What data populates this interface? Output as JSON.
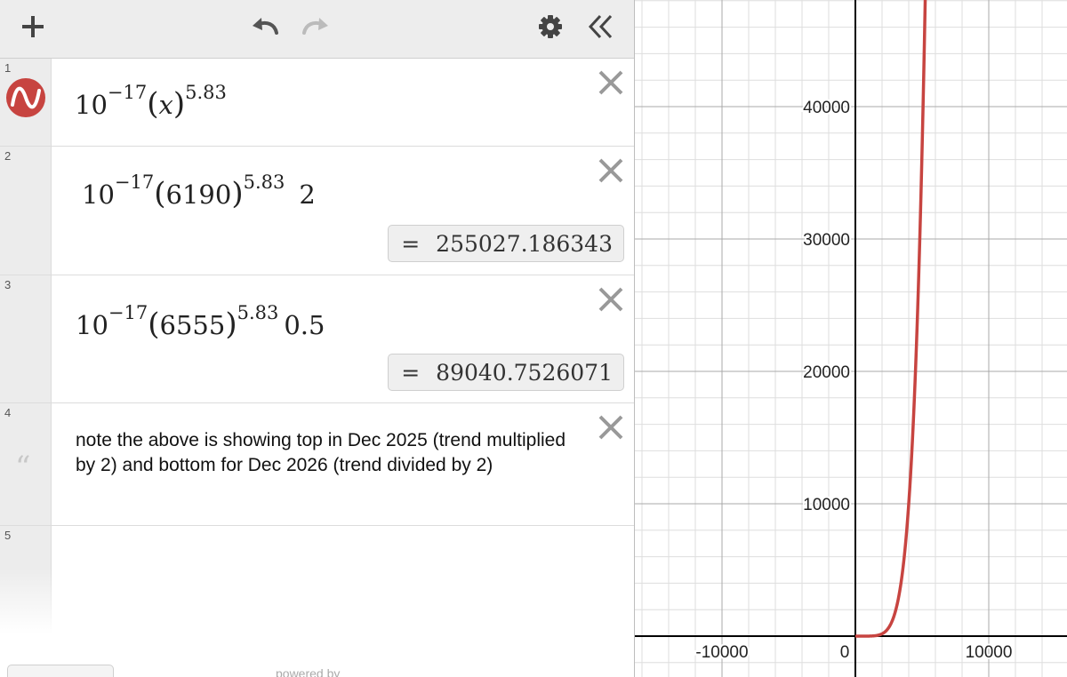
{
  "toolbar": {
    "add_icon": "plus-icon",
    "undo_icon": "undo-icon",
    "redo_icon": "redo-icon",
    "settings_icon": "gear-icon",
    "collapse_icon": "double-chevron-left-icon"
  },
  "expressions": [
    {
      "index": "1",
      "icon": "desmos-logo-icon",
      "coef": "10",
      "coef_exp": "−17",
      "arg": "x",
      "exp": "5.83",
      "mult": ""
    },
    {
      "index": "2",
      "coef": "10",
      "coef_exp": "−17",
      "arg": "6190",
      "exp": "5.83",
      "mult": "2",
      "result_eq": "=",
      "result": "255027.186343"
    },
    {
      "index": "3",
      "coef": "10",
      "coef_exp": "−17",
      "arg": "6555",
      "exp": "5.83",
      "mult": "0.5",
      "result_eq": "=",
      "result": "89040.7526071"
    },
    {
      "index": "4",
      "icon": "quote-icon",
      "quote_glyph": "“",
      "note": "note the above is showing top in Dec 2025 (trend multiplied by 2) and bottom for Dec 2026 (trend divided by 2)"
    },
    {
      "index": "5"
    }
  ],
  "footer": {
    "powered_by": "powered by"
  },
  "graph": {
    "curve_color": "#c74440",
    "axis_color": "#000000",
    "grid_major_color": "#a9a9a9",
    "grid_minor_color": "#dedede",
    "x_ticks": [
      "-10000",
      "0",
      "10000"
    ],
    "y_ticks": [
      "10000",
      "20000",
      "30000",
      "40000"
    ],
    "function": {
      "coef": 1e-17,
      "power": 5.83
    }
  }
}
